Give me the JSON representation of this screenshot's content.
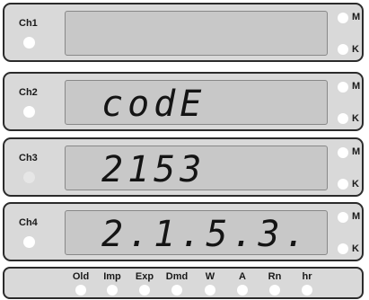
{
  "channels": [
    {
      "label": "Ch1",
      "display": "",
      "unit_m": "M",
      "unit_k": "K"
    },
    {
      "label": "Ch2",
      "display": "codE",
      "unit_m": "M",
      "unit_k": "K"
    },
    {
      "label": "Ch3",
      "display": "2153",
      "unit_m": "M",
      "unit_k": "K"
    },
    {
      "label": "Ch4",
      "display": "2.1.5.3.",
      "unit_m": "M",
      "unit_k": "K"
    }
  ],
  "indicators": [
    {
      "label": "Old"
    },
    {
      "label": "Imp"
    },
    {
      "label": "Exp"
    },
    {
      "label": "Dmd"
    },
    {
      "label": "W"
    },
    {
      "label": "A"
    },
    {
      "label": "Rn"
    },
    {
      "label": "hr"
    }
  ],
  "colors": {
    "panel": "#d9d9d9",
    "lcd": "#c8c8c8",
    "led": "#ffffff",
    "segment": "#141414"
  }
}
